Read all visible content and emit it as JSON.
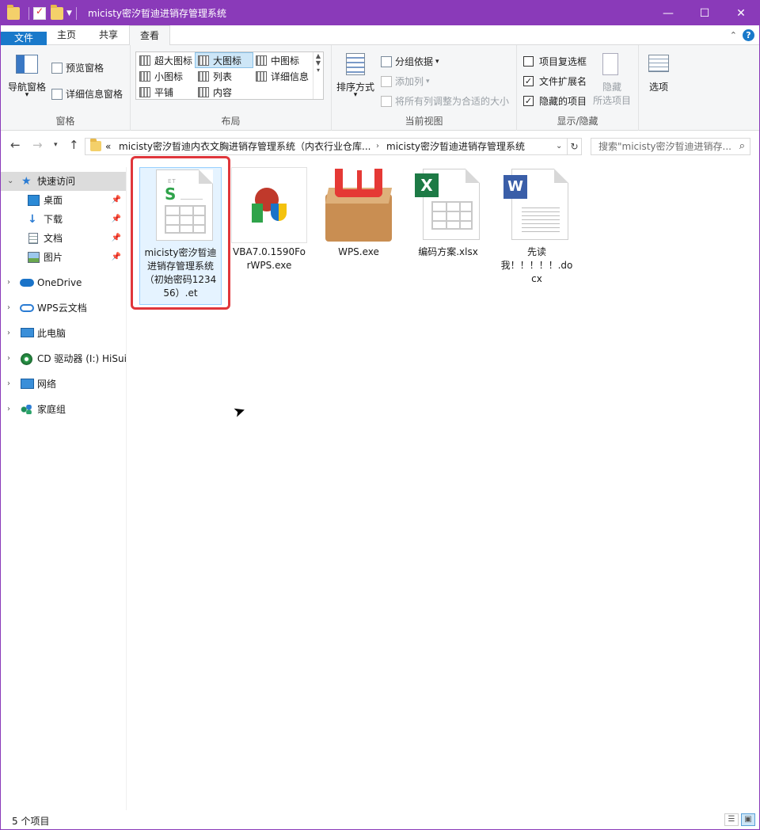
{
  "window": {
    "title": "micisty密汐晢迪进销存管理系统",
    "accent": "#8a3ab9",
    "controls": {
      "minimize": "—",
      "maximize": "☐",
      "close": "✕"
    }
  },
  "tabs": [
    {
      "label": "文件"
    },
    {
      "label": "主页"
    },
    {
      "label": "共享"
    },
    {
      "label": "查看"
    }
  ],
  "ribbon": {
    "pane": {
      "nav_pane": "导航窗格",
      "preview_pane": "预览窗格",
      "details_pane": "详细信息窗格",
      "group_label": "窗格"
    },
    "layout": {
      "items": [
        "超大图标",
        "大图标",
        "中图标",
        "小图标",
        "列表",
        "详细信息",
        "平铺",
        "内容"
      ],
      "selected": "大图标",
      "group_label": "布局"
    },
    "current_view": {
      "sort_by": "排序方式",
      "group_by": "分组依据",
      "add_columns": "添加列",
      "size_all_columns": "将所有列调整为合适的大小",
      "group_label": "当前视图"
    },
    "show_hide": {
      "item_checkboxes": {
        "label": "项目复选框",
        "checked": false
      },
      "file_extensions": {
        "label": "文件扩展名",
        "checked": true
      },
      "hidden_items": {
        "label": "隐藏的项目",
        "checked": true
      },
      "hide_selected_line1": "隐藏",
      "hide_selected_line2": "所选项目",
      "group_label": "显示/隐藏"
    },
    "options": "选项"
  },
  "address": {
    "prefix": "«",
    "crumbs": [
      "micisty密汐晢迪内衣文胸进销存管理系统（内衣行业仓库...",
      "micisty密汐晢迪进销存管理系统"
    ],
    "search_placeholder": "搜索\"micisty密汐晢迪进销存..."
  },
  "sidebar": {
    "quick_access": "快速访问",
    "pinned": [
      "桌面",
      "下载",
      "文档",
      "图片"
    ],
    "roots": [
      "OneDrive",
      "WPS云文档",
      "此电脑",
      "CD 驱动器 (I:) HiSuite",
      "网络",
      "家庭组"
    ]
  },
  "files": [
    {
      "name": "micisty密汐晢迪进销存管理系统（初始密码123456）.et",
      "icon": "et-spreadsheet-icon",
      "label_top": "ET"
    },
    {
      "name": "VBA7.0.1590ForWPS.exe",
      "icon": "installer-icon"
    },
    {
      "name": "WPS.exe",
      "icon": "wps-box-icon"
    },
    {
      "name": "编码方案.xlsx",
      "icon": "excel-icon",
      "badge": "X"
    },
    {
      "name": "先读我！！！！！.docx",
      "icon": "word-icon",
      "badge": "W"
    }
  ],
  "status": {
    "count": "5 个项目"
  }
}
